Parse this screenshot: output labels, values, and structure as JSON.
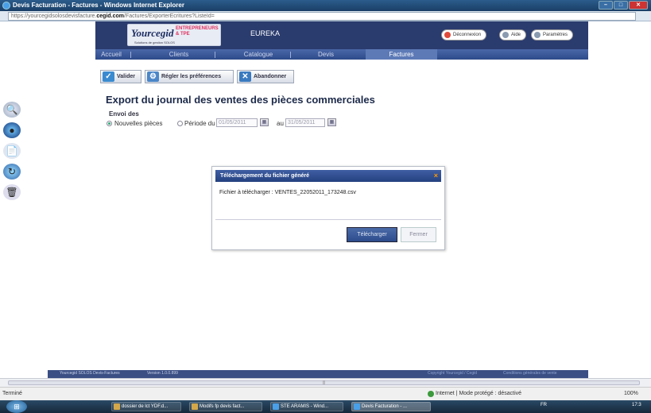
{
  "window": {
    "title": "Devis Facturation - Factures - Windows Internet Explorer"
  },
  "address": {
    "prefix": "https://yourcegidsolosdevisfacture.",
    "domain": "cegid.com",
    "path": "/Factures/ExporterEcritures?ListeId="
  },
  "header": {
    "logo_brand": "Yourcegid",
    "logo_tag": "ENTREPRENEURS & TPE",
    "logo_sub": "Solutions de gestion SOLOS",
    "app_name": "EUREKA",
    "buttons": [
      {
        "label": "Déconnexion",
        "color": "#e04a3a"
      },
      {
        "label": "Aide",
        "color": "#8a9bb0"
      },
      {
        "label": "Paramètres",
        "color": "#8a9bb0"
      }
    ]
  },
  "nav": {
    "items": [
      "Accueil",
      "Clients",
      "Catalogue",
      "Devis",
      "Factures"
    ],
    "active": "Factures"
  },
  "actions": {
    "validate": "Valider",
    "prefs": "Régler les préférences",
    "cancel": "Abandonner"
  },
  "main": {
    "title": "Export du journal des ventes des pièces commerciales",
    "envoi_label": "Envoi des",
    "option_new": "Nouvelles pièces",
    "option_period": "Période du",
    "date_from": "01/05/2011",
    "date_to_label": "au",
    "date_to": "31/05/2011"
  },
  "dialog": {
    "title": "Téléchargement du fichier généré",
    "close": "×",
    "file_text": "Fichier à télécharger : VENTES_22052011_173248.csv",
    "download": "Télécharger",
    "close_btn": "Fermer"
  },
  "footer": {
    "product": "Yourcegid SOLOS Devis-Factures",
    "version": "Version 1.0.0.899",
    "copyright": "Copyright Yourcegid / Cegid",
    "conditions": "Conditions générales de vente"
  },
  "status": {
    "left": "Terminé",
    "zone": "Internet | Mode protégé : désactivé",
    "zoom": "100%"
  },
  "taskbar": {
    "items": [
      "dossier de lct YDF.d...",
      "Modifs fp devis fact...",
      "STE ARAMIS - Wind...",
      "Devis Facturation - ..."
    ],
    "lang": "FR",
    "clock": "17:3"
  },
  "colors": {
    "nav_bg": "#2d4a8a",
    "header_bg": "#2a3b6e",
    "dialog_title": "#24407f"
  }
}
